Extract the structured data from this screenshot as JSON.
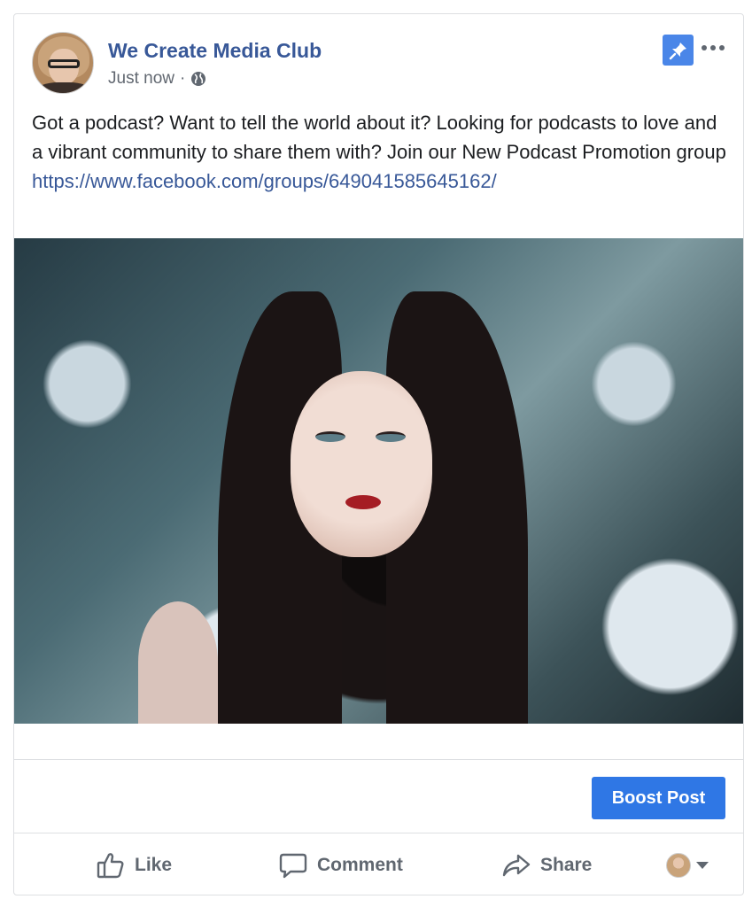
{
  "post": {
    "page_name": "We Create Media Club",
    "timestamp": "Just now",
    "separator": "·",
    "privacy_icon": "globe-icon",
    "text_line1": "Got a podcast? Want to tell the world about it? Looking for podcasts to love and a vibrant community to share them with? Join our New Podcast Promotion group",
    "link": "https://www.facebook.com/groups/649041585645162/"
  },
  "header_actions": {
    "pin_icon": "pin-icon",
    "more_icon": "more-options-icon"
  },
  "boost": {
    "label": "Boost Post"
  },
  "actions": {
    "like": "Like",
    "comment": "Comment",
    "share": "Share"
  },
  "colors": {
    "link_blue": "#385898",
    "boost_blue": "#2f77e5",
    "pin_blue": "#4a86e8",
    "action_gray": "#606770"
  }
}
